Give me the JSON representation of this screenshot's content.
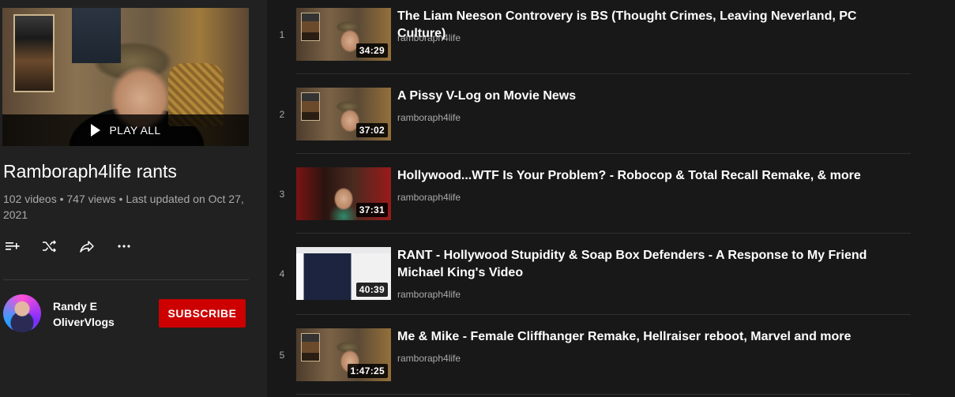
{
  "playlist": {
    "play_all_label": "PLAY ALL",
    "title": "Ramboraph4life rants",
    "meta": "102 videos • 747 views • Last updated on Oct 27, 2021",
    "actions": {
      "add_icon": "playlist-add-icon",
      "shuffle_icon": "shuffle-icon",
      "share_icon": "share-icon",
      "more_icon": "more-horizontal-icon"
    }
  },
  "owner": {
    "name": "Randy E OliverVlogs",
    "subscribe_label": "SUBSCRIBE"
  },
  "colors": {
    "background": "#181818",
    "sidebar": "#212121",
    "subscribe": "#cc0000",
    "secondary_text": "#aaaaaa"
  },
  "videos": [
    {
      "index": "1",
      "title": "The Liam Neeson Controvery is BS (Thought Crimes, Leaving Neverland, PC Culture)",
      "channel": "ramboraph4life",
      "duration": "34:29"
    },
    {
      "index": "2",
      "title": "A Pissy V-Log on Movie News",
      "channel": "ramboraph4life",
      "duration": "37:02"
    },
    {
      "index": "3",
      "title": "Hollywood...WTF Is Your Problem? - Robocop & Total Recall Remake, & more",
      "channel": "ramboraph4life",
      "duration": "37:31"
    },
    {
      "index": "4",
      "title": "RANT - Hollywood Stupidity & Soap Box Defenders - A Response to My Friend Michael King's Video",
      "channel": "ramboraph4life",
      "duration": "40:39"
    },
    {
      "index": "5",
      "title": "Me & Mike - Female Cliffhanger Remake, Hellraiser reboot, Marvel and more",
      "channel": "ramboraph4life",
      "duration": "1:47:25"
    }
  ]
}
